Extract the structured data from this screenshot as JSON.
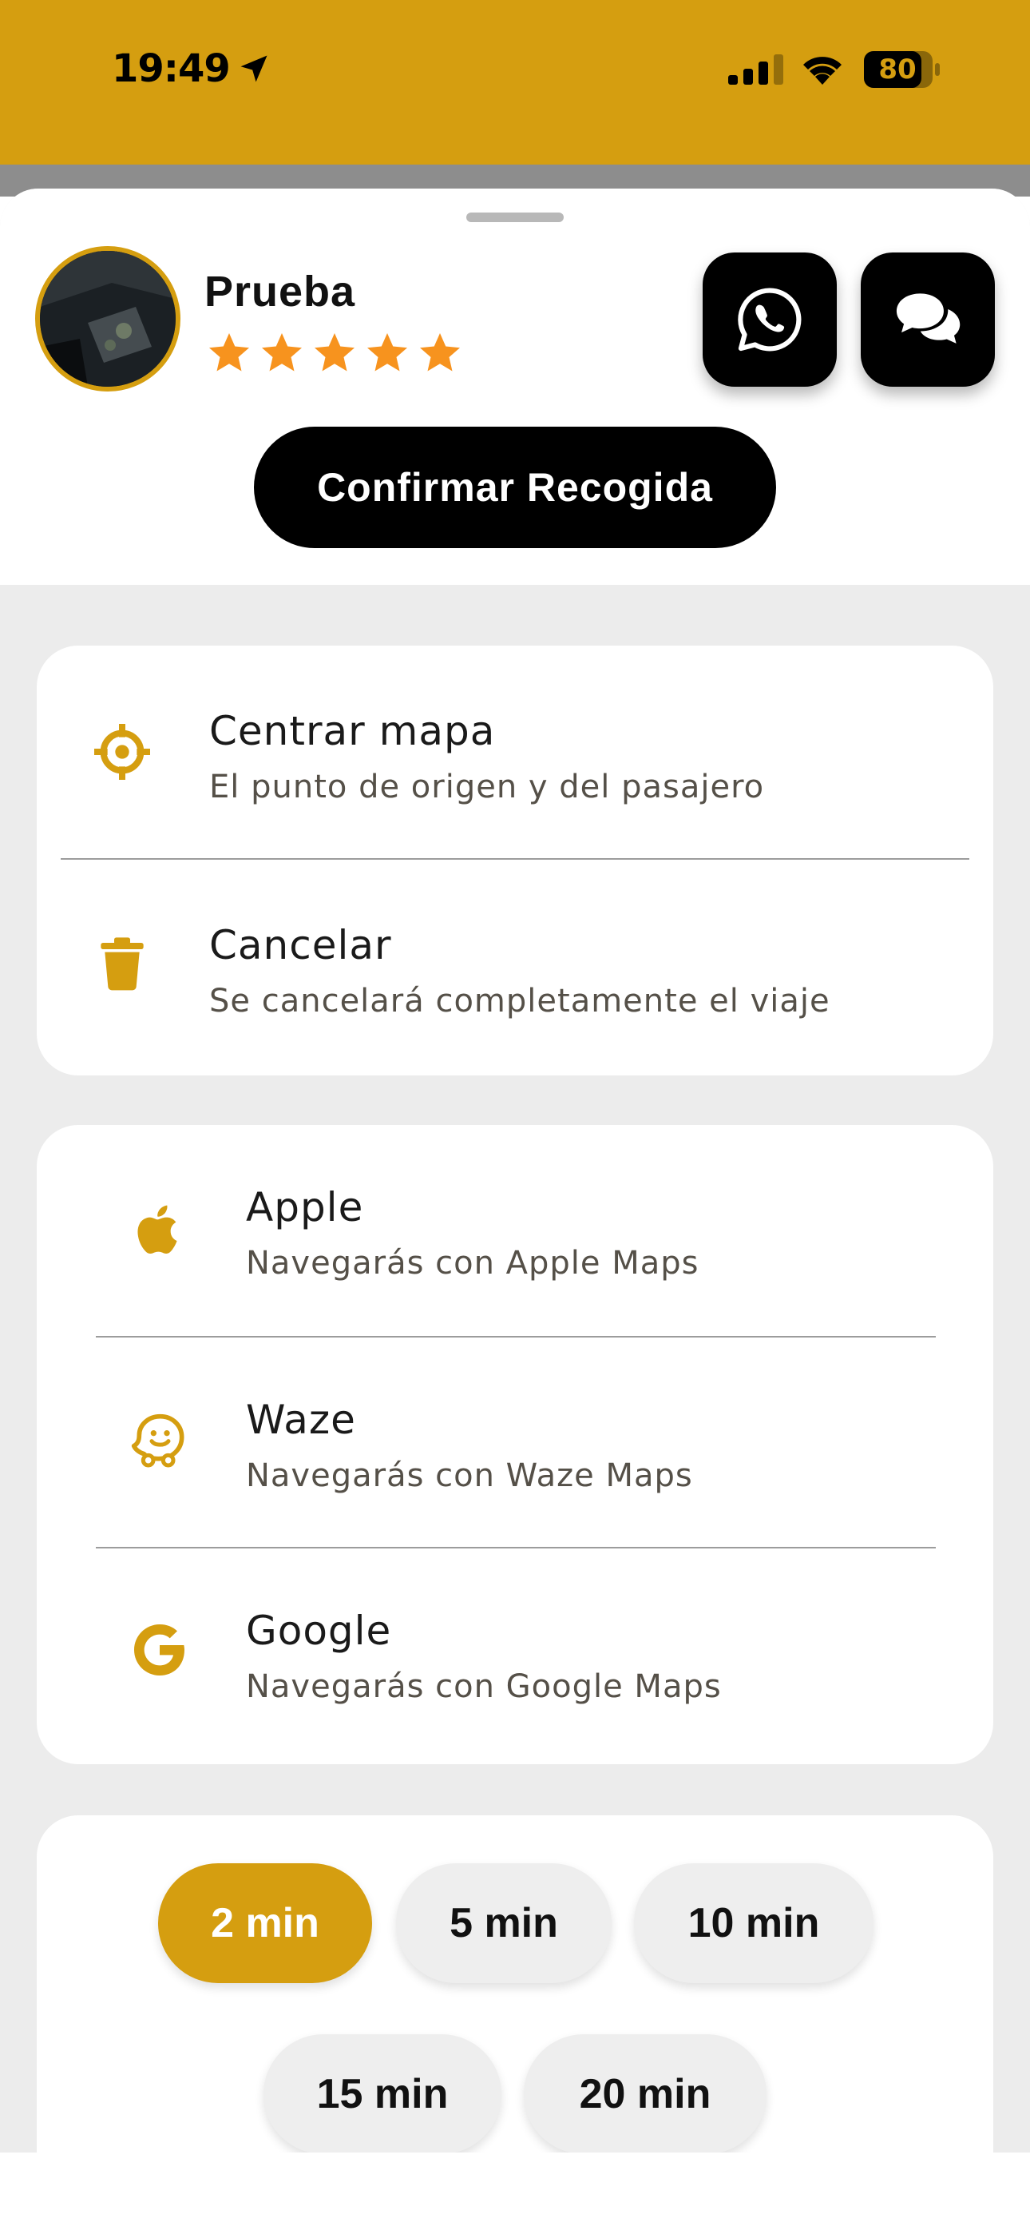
{
  "status_bar": {
    "time": "19:49",
    "battery": "80",
    "icons": [
      "location-arrow-icon",
      "signal-icon",
      "wifi-icon",
      "battery-icon"
    ]
  },
  "driver": {
    "name": "Prueba",
    "rating": 5,
    "rating_max": 5
  },
  "actions": {
    "whatsapp_icon": "whatsapp-icon",
    "chat_icon": "chat-bubbles-icon",
    "confirm_label": "Confirmar Recogida"
  },
  "options": [
    {
      "title": "Centrar mapa",
      "subtitle": "El punto de origen y del pasajero",
      "icon": "crosshair-icon"
    },
    {
      "title": "Cancelar",
      "subtitle": "Se cancelará completamente el viaje",
      "icon": "trash-icon"
    }
  ],
  "navigation": [
    {
      "title": "Apple",
      "subtitle": "Navegarás con Apple Maps",
      "icon": "apple-icon"
    },
    {
      "title": "Waze",
      "subtitle": "Navegarás con Waze Maps",
      "icon": "waze-icon"
    },
    {
      "title": "Google",
      "subtitle": "Navegarás con Google Maps",
      "icon": "google-icon"
    }
  ],
  "wait_times": {
    "selected": "2 min",
    "options": [
      "2 min",
      "5 min",
      "10 min",
      "15 min",
      "20 min"
    ]
  },
  "colors": {
    "accent": "#D59E10",
    "star": "#F7931E",
    "button": "#000000",
    "background": "#ECECEC"
  }
}
